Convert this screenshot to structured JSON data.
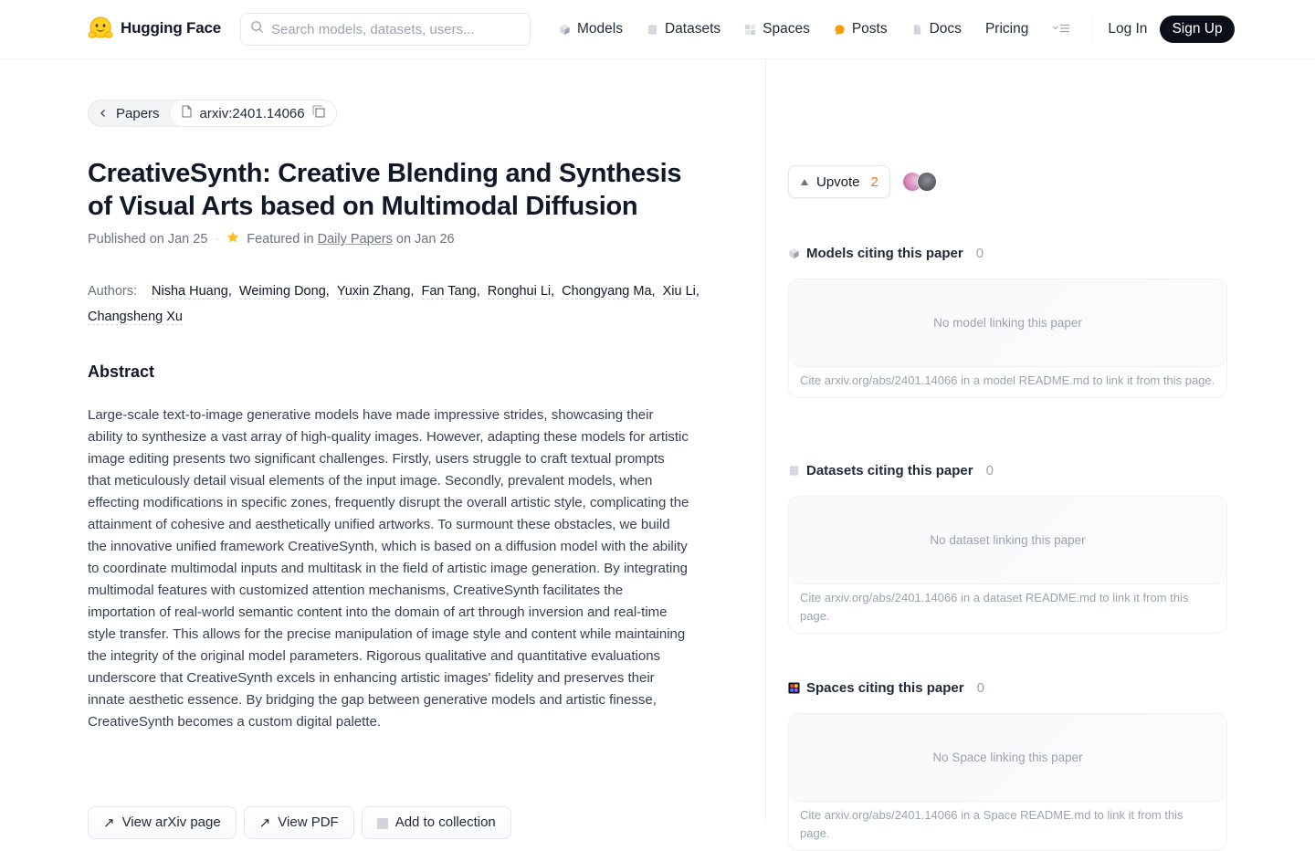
{
  "header": {
    "brand": "Hugging Face",
    "search_placeholder": "Search models, datasets, users...",
    "nav": [
      {
        "label": "Models",
        "icon": "models-cube-icon"
      },
      {
        "label": "Datasets",
        "icon": "datasets-db-icon"
      },
      {
        "label": "Spaces",
        "icon": "spaces-grid-icon"
      },
      {
        "label": "Posts",
        "icon": "posts-bubble-icon"
      },
      {
        "label": "Docs",
        "icon": "docs-file-icon"
      },
      {
        "label": "Pricing",
        "icon": null
      }
    ],
    "more_icon": "more-menu-icon",
    "login": "Log In",
    "signup": "Sign Up"
  },
  "breadcrumb": {
    "back_label": "Papers",
    "paper_id": "arxiv:2401.14066"
  },
  "paper": {
    "title": "CreativeSynth: Creative Blending and Synthesis of Visual Arts based on Multimodal Diffusion",
    "published": "Published on Jan 25",
    "featured_prefix": "Featured in",
    "featured_link": "Daily Papers",
    "featured_suffix": "on Jan 26",
    "authors_label": "Authors:",
    "authors": [
      "Nisha Huang",
      "Weiming Dong",
      "Yuxin Zhang",
      "Fan Tang",
      "Ronghui Li",
      "Chongyang Ma",
      "Xiu Li",
      "Changsheng Xu"
    ],
    "abstract_heading": "Abstract",
    "abstract": "Large-scale text-to-image generative models have made impressive strides, showcasing their ability to synthesize a vast array of high-quality images. However, adapting these models for artistic image editing presents two significant challenges. Firstly, users struggle to craft textual prompts that meticulously detail visual elements of the input image. Secondly, prevalent models, when effecting modifications in specific zones, frequently disrupt the overall artistic style, complicating the attainment of cohesive and aesthetically unified artworks. To surmount these obstacles, we build the innovative unified framework CreativeSynth, which is based on a diffusion model with the ability to coordinate multimodal inputs and multitask in the field of artistic image generation. By integrating multimodal features with customized attention mechanisms, CreativeSynth facilitates the importation of real-world semantic content into the domain of art through inversion and real-time style transfer. This allows for the precise manipulation of image style and content while maintaining the integrity of the original model parameters. Rigorous qualitative and quantitative evaluations underscore that CreativeSynth excels in enhancing artistic images' fidelity and preserves their innate aesthetic essence. By bridging the gap between generative models and artistic finesse, CreativeSynth becomes a custom digital palette.",
    "actions": [
      "View arXiv page",
      "View PDF",
      "Add to collection"
    ]
  },
  "upvote": {
    "label": "Upvote",
    "count": "2"
  },
  "sections": [
    {
      "title": "Models citing this paper",
      "count": "0",
      "empty": "No model linking this paper",
      "cite": "Cite arxiv.org/abs/2401.14066 in a model README.md to link it from this page."
    },
    {
      "title": "Datasets citing this paper",
      "count": "0",
      "empty": "No dataset linking this paper",
      "cite": "Cite arxiv.org/abs/2401.14066 in a dataset README.md to link it from this page."
    },
    {
      "title": "Spaces citing this paper",
      "count": "0",
      "empty": "No Space linking this paper",
      "cite": "Cite arxiv.org/abs/2401.14066 in a Space README.md to link it from this page."
    }
  ],
  "colors": {
    "accent_upvote": "#f97316",
    "signup_bg": "#0b0f19",
    "star": "#fbbf24"
  }
}
